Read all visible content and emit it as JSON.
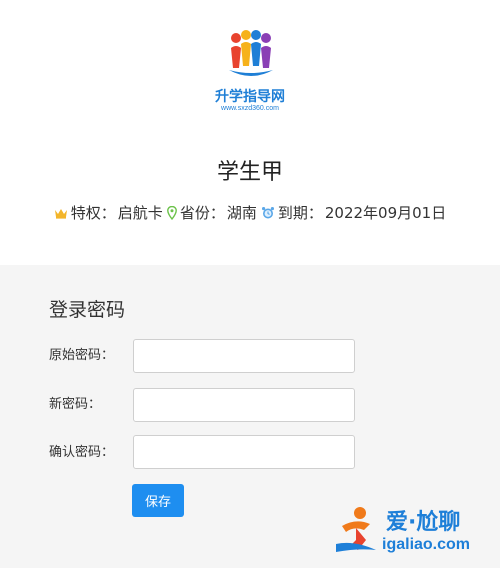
{
  "logo": {
    "text": "升学指导网",
    "url": "www.sxzd360.com"
  },
  "user": {
    "name": "学生甲"
  },
  "meta": {
    "privilege_label": "特权：",
    "privilege_value": "启航卡",
    "province_label": "省份：",
    "province_value": "湖南",
    "expiry_label": "到期：",
    "expiry_value": "2022年09月01日",
    "icons": [
      "crown-icon",
      "location-pin-icon",
      "alarm-clock-icon"
    ]
  },
  "password_form": {
    "title": "登录密码",
    "old_label": "原始密码：",
    "old_value": "",
    "new_label": "新密码：",
    "new_value": "",
    "confirm_label": "确认密码：",
    "confirm_value": "",
    "save_label": "保存"
  },
  "watermark": {
    "title": "爱·尬聊",
    "url": "igaliao.com"
  },
  "colors": {
    "accent": "#1e8ef0",
    "panel_bg": "#f5f5f5",
    "crown": "#f3b52a",
    "pin": "#6cc24a",
    "clock": "#5aa7e8"
  }
}
